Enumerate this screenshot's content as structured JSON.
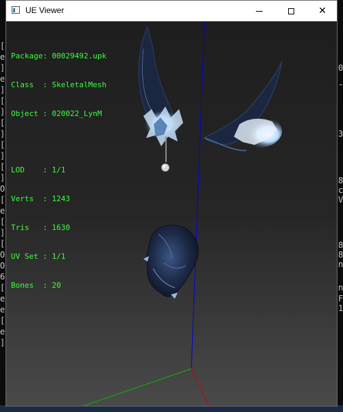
{
  "window": {
    "title": "UE Viewer"
  },
  "controls": {
    "minimize": "minimize",
    "maximize": "maximize",
    "close": "✕"
  },
  "info": {
    "package_label": "Package: ",
    "package_value": "00029492.upk",
    "class_label": "Class  : ",
    "class_value": "SkeletalMesh",
    "object_label": "Object : ",
    "object_value": "020022_LynM",
    "lod_label": "LOD    : ",
    "lod_value": "1/1",
    "verts_label": "Verts  : ",
    "verts_value": "1243",
    "tris_label": "Tris   : ",
    "tris_value": "1630",
    "uvset_label": "UV Set : ",
    "uvset_value": "1/1",
    "bones_label": "Bones  : ",
    "bones_value": "20"
  },
  "background_console": {
    "left_chars": [
      "[",
      "e",
      "]",
      "e",
      "]",
      "[",
      "]",
      "[",
      "]",
      "[",
      "]",
      "[",
      "]",
      "O",
      "[",
      "e",
      "[",
      "]",
      "[",
      "O",
      "O",
      "6",
      "[",
      "e",
      "e",
      "[",
      "e",
      "]"
    ],
    "right_chars": [
      "0",
      "-",
      "3",
      "8",
      "c",
      "V",
      "8",
      "8",
      "n",
      "n",
      "F",
      "1"
    ]
  },
  "colors": {
    "info_text": "#3cff3c",
    "axis_x": "#d00000",
    "axis_y": "#00c000",
    "axis_z": "#0000dd",
    "mesh_dark": "#1b2740",
    "mesh_highlight": "#c8e4ff"
  }
}
